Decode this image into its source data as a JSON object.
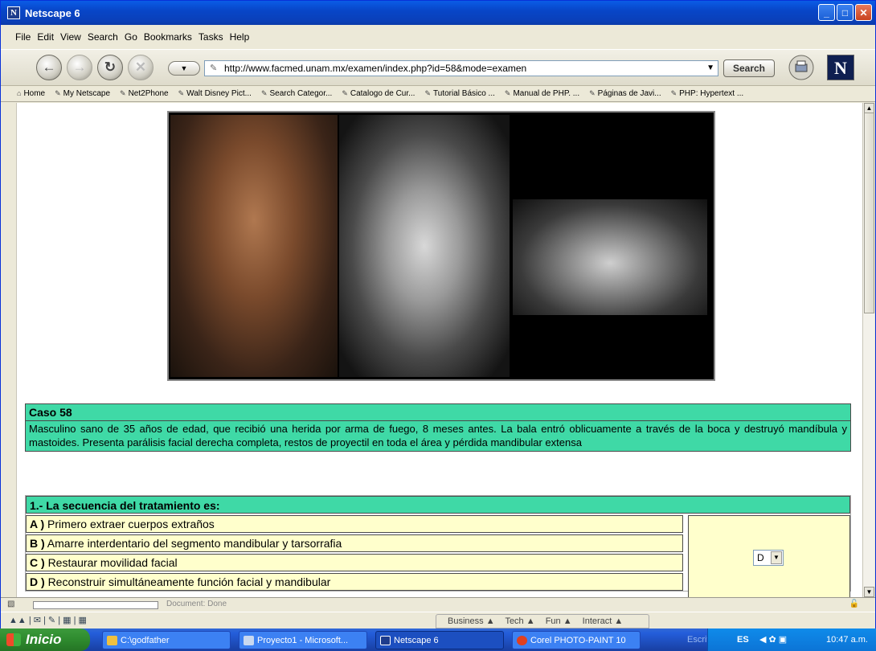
{
  "window": {
    "title": "Netscape 6",
    "controls": {
      "minimize": "_",
      "maximize": "□",
      "close": "✕"
    }
  },
  "menu": [
    "File",
    "Edit",
    "View",
    "Search",
    "Go",
    "Bookmarks",
    "Tasks",
    "Help"
  ],
  "navigation": {
    "url": "http://www.facmed.unam.mx/examen/index.php?id=58&mode=examen",
    "search_label": "Search",
    "logo_letter": "N",
    "icons": [
      "back-icon",
      "forward-icon",
      "reload-icon",
      "stop-icon"
    ]
  },
  "bookmarks": [
    "Home",
    "My Netscape",
    "Net2Phone",
    "Walt Disney Pict...",
    "Search Categor...",
    "Catalogo de Cur...",
    "Tutorial Básico ...",
    "Manual de PHP. ...",
    "Páginas de Javi...",
    "PHP: Hypertext ..."
  ],
  "case": {
    "title": "Caso 58",
    "text": "Masculino sano de 35 años de edad, que recibió una herida por arma de fuego, 8 meses antes. La bala entró oblicuamente a través de la boca y destruyó mandíbula y mastoides. Presenta parálisis facial derecha completa, restos de proyectil en toda el área y pérdida mandibular extensa"
  },
  "question": {
    "title": "1.- La secuencia del tratamiento es:",
    "options": [
      {
        "letter": "A )",
        "text": "Primero extraer cuerpos extraños"
      },
      {
        "letter": "B )",
        "text": "Amarre interdentario del segmento mandibular y tarsorrafia"
      },
      {
        "letter": "C )",
        "text": "Restaurar movilidad facial"
      },
      {
        "letter": "D )",
        "text": "Reconstruir simultáneamente función facial y mandibular"
      }
    ],
    "selected_answer": "D"
  },
  "statusbar": {
    "text": "Document: Done"
  },
  "component_bar": {
    "tabs": [
      "Business ▲",
      "Tech ▲",
      "Fun ▲",
      "Interact ▲"
    ]
  },
  "taskbar": {
    "start_label": "Inicio",
    "tasks": [
      "C:\\godfather",
      "Proyecto1 - Microsoft...",
      "Netscape 6",
      "Corel PHOTO-PAINT 10"
    ],
    "desktop_label": "Escritorio",
    "lang": "ES",
    "clock": "10:47 a.m."
  },
  "colors": {
    "case_bg": "#3fd9a6",
    "option_bg": "#ffffcc",
    "titlebar": "#0a5ce6",
    "taskbar": "#245edb",
    "start": "#2e8a2e"
  }
}
